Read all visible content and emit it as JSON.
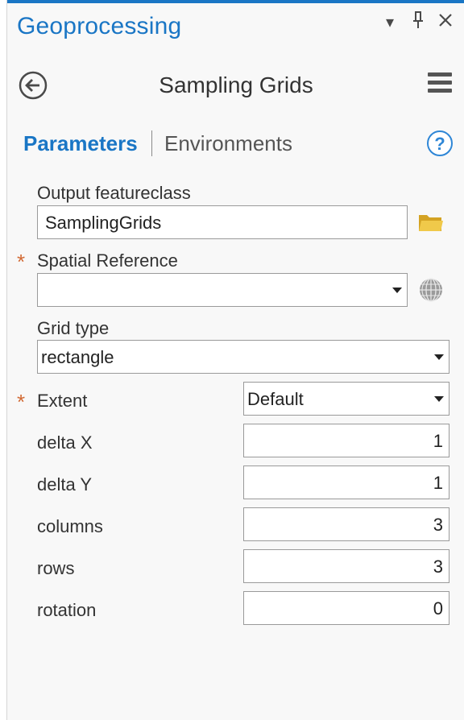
{
  "pane": {
    "title": "Geoprocessing",
    "controls": {
      "dropdown": "▾",
      "pin": "⊥",
      "close": "✕"
    }
  },
  "tool": {
    "title": "Sampling Grids"
  },
  "tabs": {
    "parameters": "Parameters",
    "environments": "Environments"
  },
  "params": {
    "output_featureclass": {
      "label": "Output featureclass",
      "value": "SamplingGrids"
    },
    "spatial_reference": {
      "label": "Spatial Reference",
      "value": ""
    },
    "grid_type": {
      "label": "Grid type",
      "value": "rectangle"
    },
    "extent": {
      "label": "Extent",
      "value": "Default"
    },
    "delta_x": {
      "label": "delta X",
      "value": "1"
    },
    "delta_y": {
      "label": "delta Y",
      "value": "1"
    },
    "columns": {
      "label": "columns",
      "value": "3"
    },
    "rows": {
      "label": "rows",
      "value": "3"
    },
    "rotation": {
      "label": "rotation",
      "value": "0"
    }
  },
  "required_marker": "*",
  "icons": {
    "back": "back-arrow-icon",
    "menu": "hamburger-menu-icon",
    "help": "help-icon",
    "folder": "folder-icon",
    "globe": "globe-icon"
  },
  "colors": {
    "accent": "#1a76c5",
    "required": "#d26a34",
    "folder": "#e6b93a"
  }
}
